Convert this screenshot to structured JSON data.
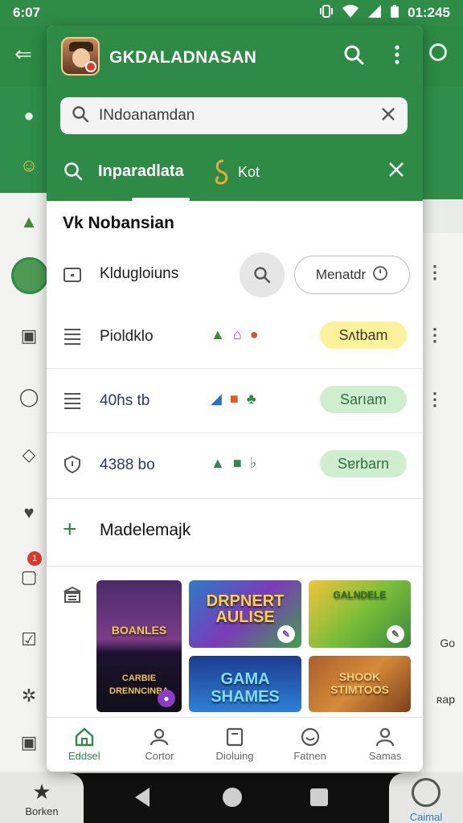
{
  "status_bar": {
    "time": "6:07",
    "right_time": "01:245"
  },
  "background_app": {
    "bottom_left_label": "Borken",
    "bottom_right_label": "Caimal",
    "badge_count": "1",
    "right_texts": [
      "Go",
      "ʀap"
    ]
  },
  "sheet": {
    "app_title": "GKDALADNASAN",
    "search_value": "INdoanamdan",
    "tabs": {
      "active": "Inparadlata",
      "second": "Kot"
    },
    "section_title": "Vk  Nobansian",
    "first_row": {
      "label": "Kldugloiuns",
      "pill": "Menatdr"
    },
    "items": [
      {
        "label": "Pioldklo",
        "pill": "Sʌtbam",
        "pill_style": "yellow"
      },
      {
        "label": "40ɦs tb",
        "pill": "Sarıam",
        "pill_style": "green"
      },
      {
        "label": "4388 bo",
        "pill": "Sɐrbarn",
        "pill_style": "green"
      }
    ],
    "add_label": "Madelemajk",
    "games": [
      {
        "title": "BOANLES"
      },
      {
        "title": "DRPNERT AULISE"
      },
      {
        "title": "GALNDELE"
      },
      {
        "title": "CARBIE DRENNCINBA"
      },
      {
        "title": "GAMA SHAMES"
      },
      {
        "title": "SHOOK STIMTOOS"
      }
    ],
    "bottom_tabs": [
      "Eddsel",
      "Cortor",
      "Dioluing",
      "Fatnen",
      "Samas"
    ]
  },
  "colors": {
    "primary": "#2e8b46",
    "pill_yellow": "#fbf29a",
    "pill_green": "#cfeed0"
  }
}
